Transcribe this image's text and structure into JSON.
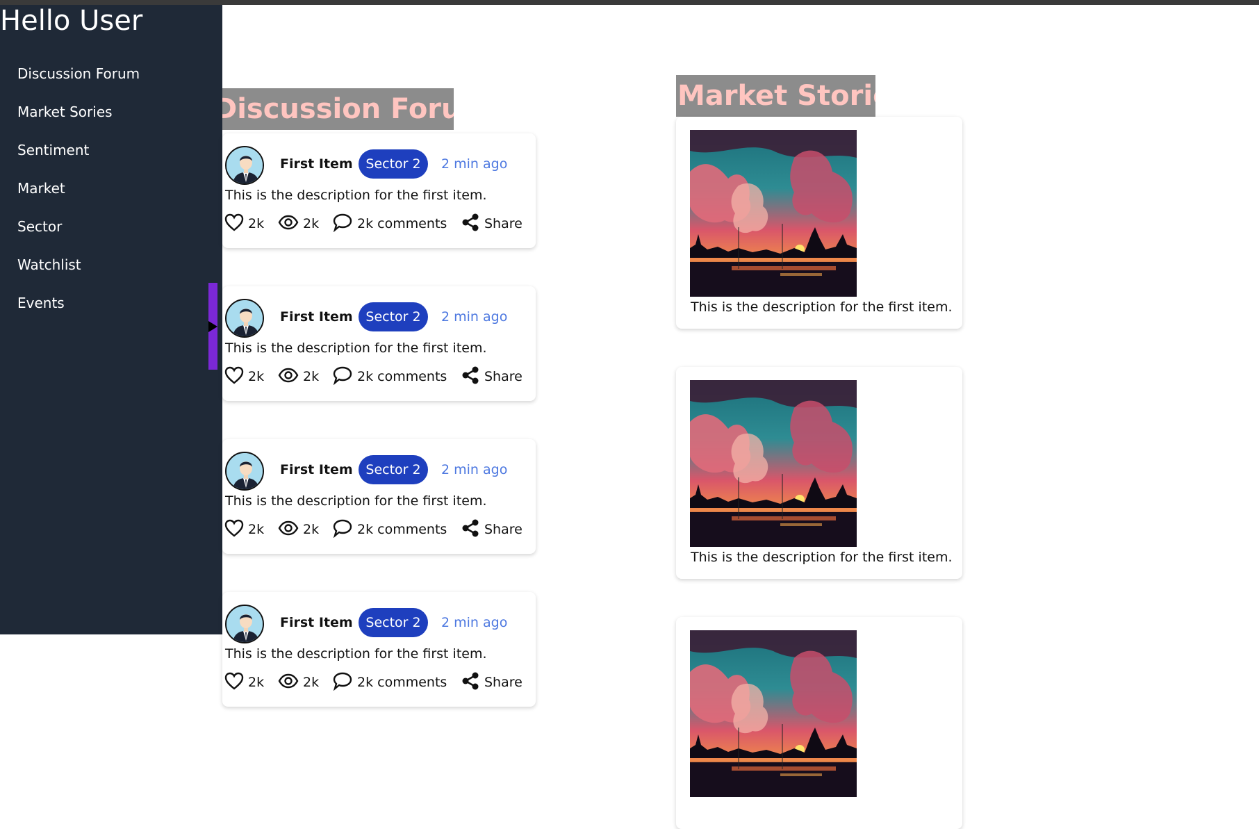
{
  "sidebar": {
    "greeting": "Hello User",
    "items": [
      {
        "label": "Discussion Forum"
      },
      {
        "label": "Market Sories"
      },
      {
        "label": "Sentiment"
      },
      {
        "label": "Market"
      },
      {
        "label": "Sector"
      },
      {
        "label": "Watchlist"
      },
      {
        "label": "Events"
      }
    ]
  },
  "forum": {
    "title": "Discussion Forum",
    "posts": [
      {
        "title": "First Item",
        "sector": "Sector 2",
        "time": "2 min ago",
        "description": "This is the description for the first item.",
        "likes": "2k",
        "views": "2k",
        "comments": "2k comments",
        "share": "Share"
      },
      {
        "title": "First Item",
        "sector": "Sector 2",
        "time": "2 min ago",
        "description": "This is the description for the first item.",
        "likes": "2k",
        "views": "2k",
        "comments": "2k comments",
        "share": "Share"
      },
      {
        "title": "First Item",
        "sector": "Sector 2",
        "time": "2 min ago",
        "description": "This is the description for the first item.",
        "likes": "2k",
        "views": "2k",
        "comments": "2k comments",
        "share": "Share"
      },
      {
        "title": "First Item",
        "sector": "Sector 2",
        "time": "2 min ago",
        "description": "This is the description for the first item.",
        "likes": "2k",
        "views": "2k",
        "comments": "2k comments",
        "share": "Share"
      }
    ]
  },
  "stories": {
    "title": "Market Stories",
    "items": [
      {
        "description": "This is the description for the first item."
      },
      {
        "description": "This is the description for the first item."
      },
      {
        "description": ""
      }
    ]
  },
  "colors": {
    "sidebar_bg": "#1f2937",
    "accent_purple": "#7b28d6",
    "badge_blue": "#1e3fbe",
    "time_blue": "#4d78e0",
    "title_pink": "#ffc5c0",
    "title_bg": "#8c8c8c"
  }
}
